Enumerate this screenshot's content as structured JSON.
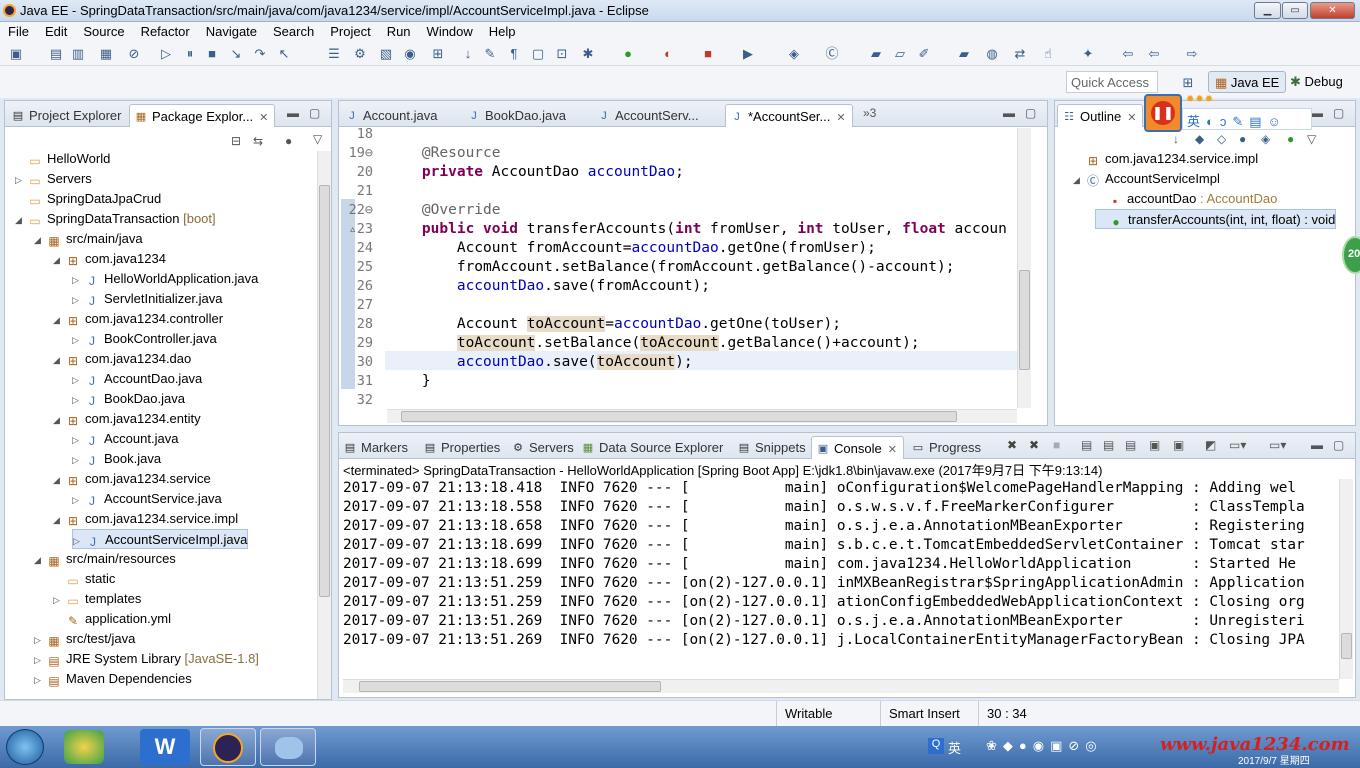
{
  "window": {
    "title": "Java EE - SpringDataTransaction/src/main/java/com/java1234/service/impl/AccountServiceImpl.java - Eclipse",
    "min": "▁",
    "max": "▭",
    "close": "✕"
  },
  "menu": [
    "File",
    "Edit",
    "Source",
    "Refactor",
    "Navigate",
    "Search",
    "Project",
    "Run",
    "Window",
    "Help"
  ],
  "perspective": {
    "quick_access_placeholder": "Quick Access",
    "java_ee": "Java EE",
    "debug": "Debug"
  },
  "project_explorer": {
    "tabs": [
      {
        "label": "Project Explorer"
      },
      {
        "label": "Package Explor..."
      }
    ],
    "tree": [
      {
        "indent": 0,
        "twisty": "",
        "icon": "folder",
        "label": "HelloWorld",
        "suffix": ""
      },
      {
        "indent": 0,
        "twisty": "▷",
        "icon": "folder",
        "label": "Servers",
        "suffix": ""
      },
      {
        "indent": 0,
        "twisty": "",
        "icon": "folder",
        "label": "SpringDataJpaCrud",
        "suffix": ""
      },
      {
        "indent": 0,
        "twisty": "◢",
        "icon": "folder",
        "label": "SpringDataTransaction",
        "suffix": "[boot]"
      },
      {
        "indent": 1,
        "twisty": "◢",
        "icon": "srcfolder",
        "label": "src/main/java",
        "suffix": ""
      },
      {
        "indent": 2,
        "twisty": "◢",
        "icon": "package",
        "label": "com.java1234",
        "suffix": ""
      },
      {
        "indent": 3,
        "twisty": "▷",
        "icon": "java",
        "label": "HelloWorldApplication.java",
        "suffix": ""
      },
      {
        "indent": 3,
        "twisty": "▷",
        "icon": "java",
        "label": "ServletInitializer.java",
        "suffix": ""
      },
      {
        "indent": 2,
        "twisty": "◢",
        "icon": "package",
        "label": "com.java1234.controller",
        "suffix": ""
      },
      {
        "indent": 3,
        "twisty": "▷",
        "icon": "java",
        "label": "BookController.java",
        "suffix": ""
      },
      {
        "indent": 2,
        "twisty": "◢",
        "icon": "package",
        "label": "com.java1234.dao",
        "suffix": ""
      },
      {
        "indent": 3,
        "twisty": "▷",
        "icon": "java",
        "label": "AccountDao.java",
        "suffix": ""
      },
      {
        "indent": 3,
        "twisty": "▷",
        "icon": "java",
        "label": "BookDao.java",
        "suffix": ""
      },
      {
        "indent": 2,
        "twisty": "◢",
        "icon": "package",
        "label": "com.java1234.entity",
        "suffix": ""
      },
      {
        "indent": 3,
        "twisty": "▷",
        "icon": "java",
        "label": "Account.java",
        "suffix": ""
      },
      {
        "indent": 3,
        "twisty": "▷",
        "icon": "java",
        "label": "Book.java",
        "suffix": ""
      },
      {
        "indent": 2,
        "twisty": "◢",
        "icon": "package",
        "label": "com.java1234.service",
        "suffix": ""
      },
      {
        "indent": 3,
        "twisty": "▷",
        "icon": "java",
        "label": "AccountService.java",
        "suffix": ""
      },
      {
        "indent": 2,
        "twisty": "◢",
        "icon": "package",
        "label": "com.java1234.service.impl",
        "suffix": ""
      },
      {
        "indent": 3,
        "twisty": "▷",
        "icon": "java",
        "label": "AccountServiceImpl.java",
        "suffix": "",
        "selected": true
      },
      {
        "indent": 1,
        "twisty": "◢",
        "icon": "srcfolder",
        "label": "src/main/resources",
        "suffix": ""
      },
      {
        "indent": 2,
        "twisty": "",
        "icon": "folder",
        "label": "static",
        "suffix": ""
      },
      {
        "indent": 2,
        "twisty": "▷",
        "icon": "folder",
        "label": "templates",
        "suffix": ""
      },
      {
        "indent": 2,
        "twisty": "",
        "icon": "file",
        "label": "application.yml",
        "suffix": ""
      },
      {
        "indent": 1,
        "twisty": "▷",
        "icon": "srcfolder",
        "label": "src/test/java",
        "suffix": ""
      },
      {
        "indent": 1,
        "twisty": "▷",
        "icon": "library",
        "label": "JRE System Library",
        "suffix": "[JavaSE-1.8]"
      },
      {
        "indent": 1,
        "twisty": "▷",
        "icon": "library",
        "label": "Maven Dependencies",
        "suffix": ""
      }
    ]
  },
  "editor": {
    "tabs": [
      {
        "label": "Account.java"
      },
      {
        "label": "BookDao.java"
      },
      {
        "label": "AccountServ..."
      },
      {
        "label": "*AccountSer...",
        "active": true
      }
    ],
    "overflow": "»3",
    "lines": [
      {
        "n": "18",
        "code": ""
      },
      {
        "n": "19⊖",
        "code": "    @Resource"
      },
      {
        "n": "20",
        "code": "    private AccountDao accountDao;"
      },
      {
        "n": "21",
        "code": ""
      },
      {
        "n": "22⊖",
        "code": "    @Override"
      },
      {
        "n": "▵23",
        "code": "    public void transferAccounts(int fromUser, int toUser, float accoun"
      },
      {
        "n": "24",
        "code": "        Account fromAccount=accountDao.getOne(fromUser);"
      },
      {
        "n": "25",
        "code": "        fromAccount.setBalance(fromAccount.getBalance()-account);"
      },
      {
        "n": "26",
        "code": "        accountDao.save(fromAccount);"
      },
      {
        "n": "27",
        "code": ""
      },
      {
        "n": "28",
        "code": "        Account toAccount=accountDao.getOne(toUser);"
      },
      {
        "n": "29",
        "code": "        toAccount.setBalance(toAccount.getBalance()+account);"
      },
      {
        "n": "30",
        "code": "        accountDao.save(toAccount);"
      },
      {
        "n": "31",
        "code": "    }"
      },
      {
        "n": "32",
        "code": ""
      }
    ]
  },
  "outline": {
    "tab": "Outline",
    "items": [
      {
        "indent": 0,
        "twisty": "",
        "icon": "package",
        "label": "com.java1234.service.impl",
        "type": ""
      },
      {
        "indent": 0,
        "twisty": "◢",
        "icon": "class",
        "label": "AccountServiceImpl",
        "type": ""
      },
      {
        "indent": 1,
        "twisty": "",
        "icon": "field",
        "label": "accountDao",
        "type": " : AccountDao"
      },
      {
        "indent": 1,
        "twisty": "",
        "icon": "method",
        "label": "transferAccounts(int, int, float) : void",
        "type": ""
      }
    ]
  },
  "console": {
    "tabs": [
      {
        "label": "Markers"
      },
      {
        "label": "Properties"
      },
      {
        "label": "Servers"
      },
      {
        "label": "Data Source Explorer"
      },
      {
        "label": "Snippets"
      },
      {
        "label": "Console",
        "active": true
      },
      {
        "label": "Progress"
      }
    ],
    "header": "<terminated> SpringDataTransaction - HelloWorldApplication [Spring Boot App] E:\\jdk1.8\\bin\\javaw.exe (2017年9月7日 下午9:13:14)",
    "lines": [
      "2017-09-07 21:13:18.418  INFO 7620 --- [           main] oConfiguration$WelcomePageHandlerMapping : Adding wel",
      "2017-09-07 21:13:18.558  INFO 7620 --- [           main] o.s.w.s.v.f.FreeMarkerConfigurer         : ClassTempla",
      "2017-09-07 21:13:18.658  INFO 7620 --- [           main] o.s.j.e.a.AnnotationMBeanExporter        : Registering",
      "2017-09-07 21:13:18.699  INFO 7620 --- [           main] s.b.c.e.t.TomcatEmbeddedServletContainer : Tomcat star",
      "2017-09-07 21:13:18.699  INFO 7620 --- [           main] com.java1234.HelloWorldApplication       : Started He",
      "2017-09-07 21:13:51.259  INFO 7620 --- [on(2)-127.0.0.1] inMXBeanRegistrar$SpringApplicationAdmin : Application",
      "2017-09-07 21:13:51.259  INFO 7620 --- [on(2)-127.0.0.1] ationConfigEmbeddedWebApplicationContext : Closing org",
      "2017-09-07 21:13:51.269  INFO 7620 --- [on(2)-127.0.0.1] o.s.j.e.a.AnnotationMBeanExporter        : Unregisteri",
      "2017-09-07 21:13:51.269  INFO 7620 --- [on(2)-127.0.0.1] j.LocalContainerEntityManagerFactoryBean : Closing JPA"
    ]
  },
  "status": {
    "writable": "Writable",
    "insert_mode": "Smart Insert",
    "position": "30 : 34"
  },
  "taskbar": {
    "ime": "英",
    "watermark": "www.java1234.com",
    "date": "2017/9/7 星期四"
  },
  "colors": {
    "keyword": "#7f0055",
    "field": "#0000c0",
    "annotation": "#646464",
    "occurrence": "#e8dcc8"
  }
}
